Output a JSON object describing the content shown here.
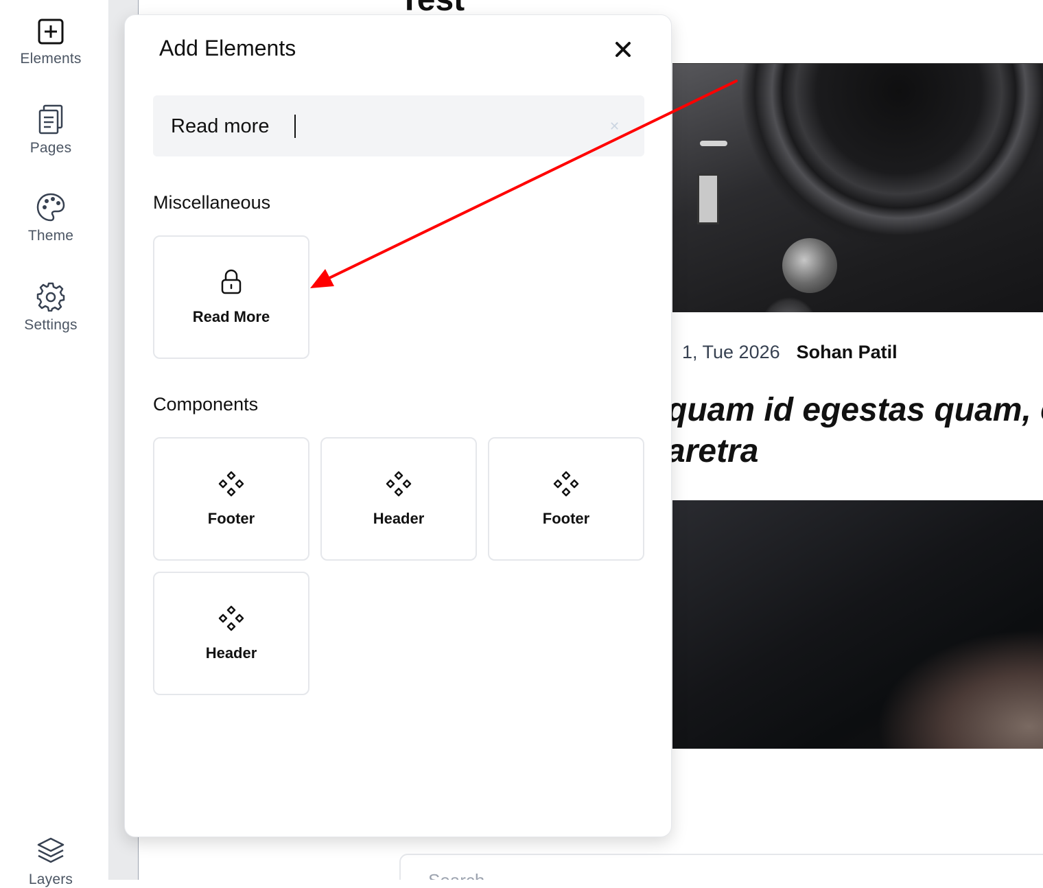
{
  "sidebar": {
    "items": [
      {
        "label": "Elements",
        "icon": "plus-square-icon"
      },
      {
        "label": "Pages",
        "icon": "pages-icon"
      },
      {
        "label": "Theme",
        "icon": "palette-icon"
      },
      {
        "label": "Settings",
        "icon": "gear-icon"
      },
      {
        "label": "Layers",
        "icon": "layers-icon"
      }
    ]
  },
  "canvas": {
    "title": "Test",
    "meta_date": "1, Tue 2026",
    "meta_author": "Sohan Patil",
    "headline_line1": "quam id egestas quam, e",
    "headline_line2": "aretra",
    "search_placeholder": "Search"
  },
  "modal": {
    "title": "Add Elements",
    "close_icon": "close-icon",
    "search_value": "Read more",
    "sections": [
      {
        "title": "Miscellaneous",
        "cards": [
          {
            "label": "Read More",
            "icon": "lock-icon"
          }
        ]
      },
      {
        "title": "Components",
        "cards": [
          {
            "label": "Footer",
            "icon": "component-icon"
          },
          {
            "label": "Header",
            "icon": "component-icon"
          },
          {
            "label": "Footer",
            "icon": "component-icon"
          },
          {
            "label": "Header",
            "icon": "component-icon"
          }
        ]
      }
    ]
  },
  "annotation": {
    "color": "#ff0000",
    "type": "arrow"
  }
}
